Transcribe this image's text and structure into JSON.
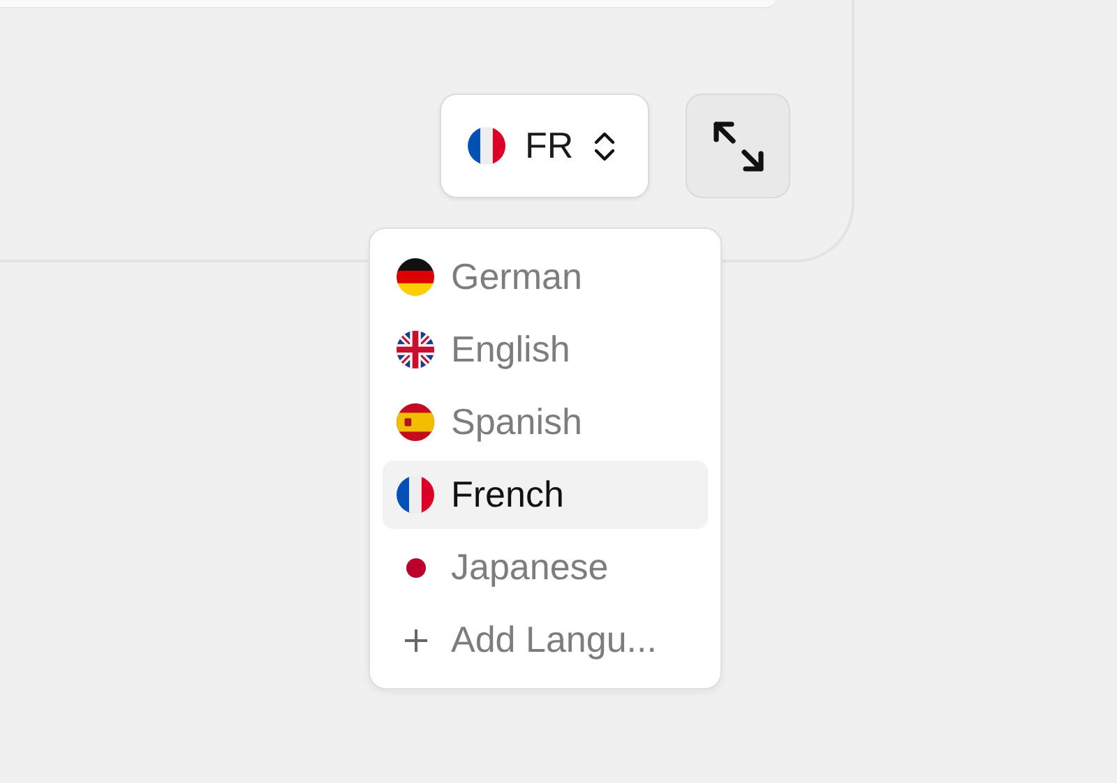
{
  "language_selector": {
    "code": "FR"
  },
  "language_menu": {
    "items": [
      {
        "kind": "language",
        "label": "German",
        "selected": false
      },
      {
        "kind": "language",
        "label": "English",
        "selected": false
      },
      {
        "kind": "language",
        "label": "Spanish",
        "selected": false
      },
      {
        "kind": "language",
        "label": "French",
        "selected": true
      },
      {
        "kind": "language",
        "label": "Japanese",
        "selected": false
      },
      {
        "kind": "add",
        "label": "Add Langu..."
      }
    ]
  }
}
